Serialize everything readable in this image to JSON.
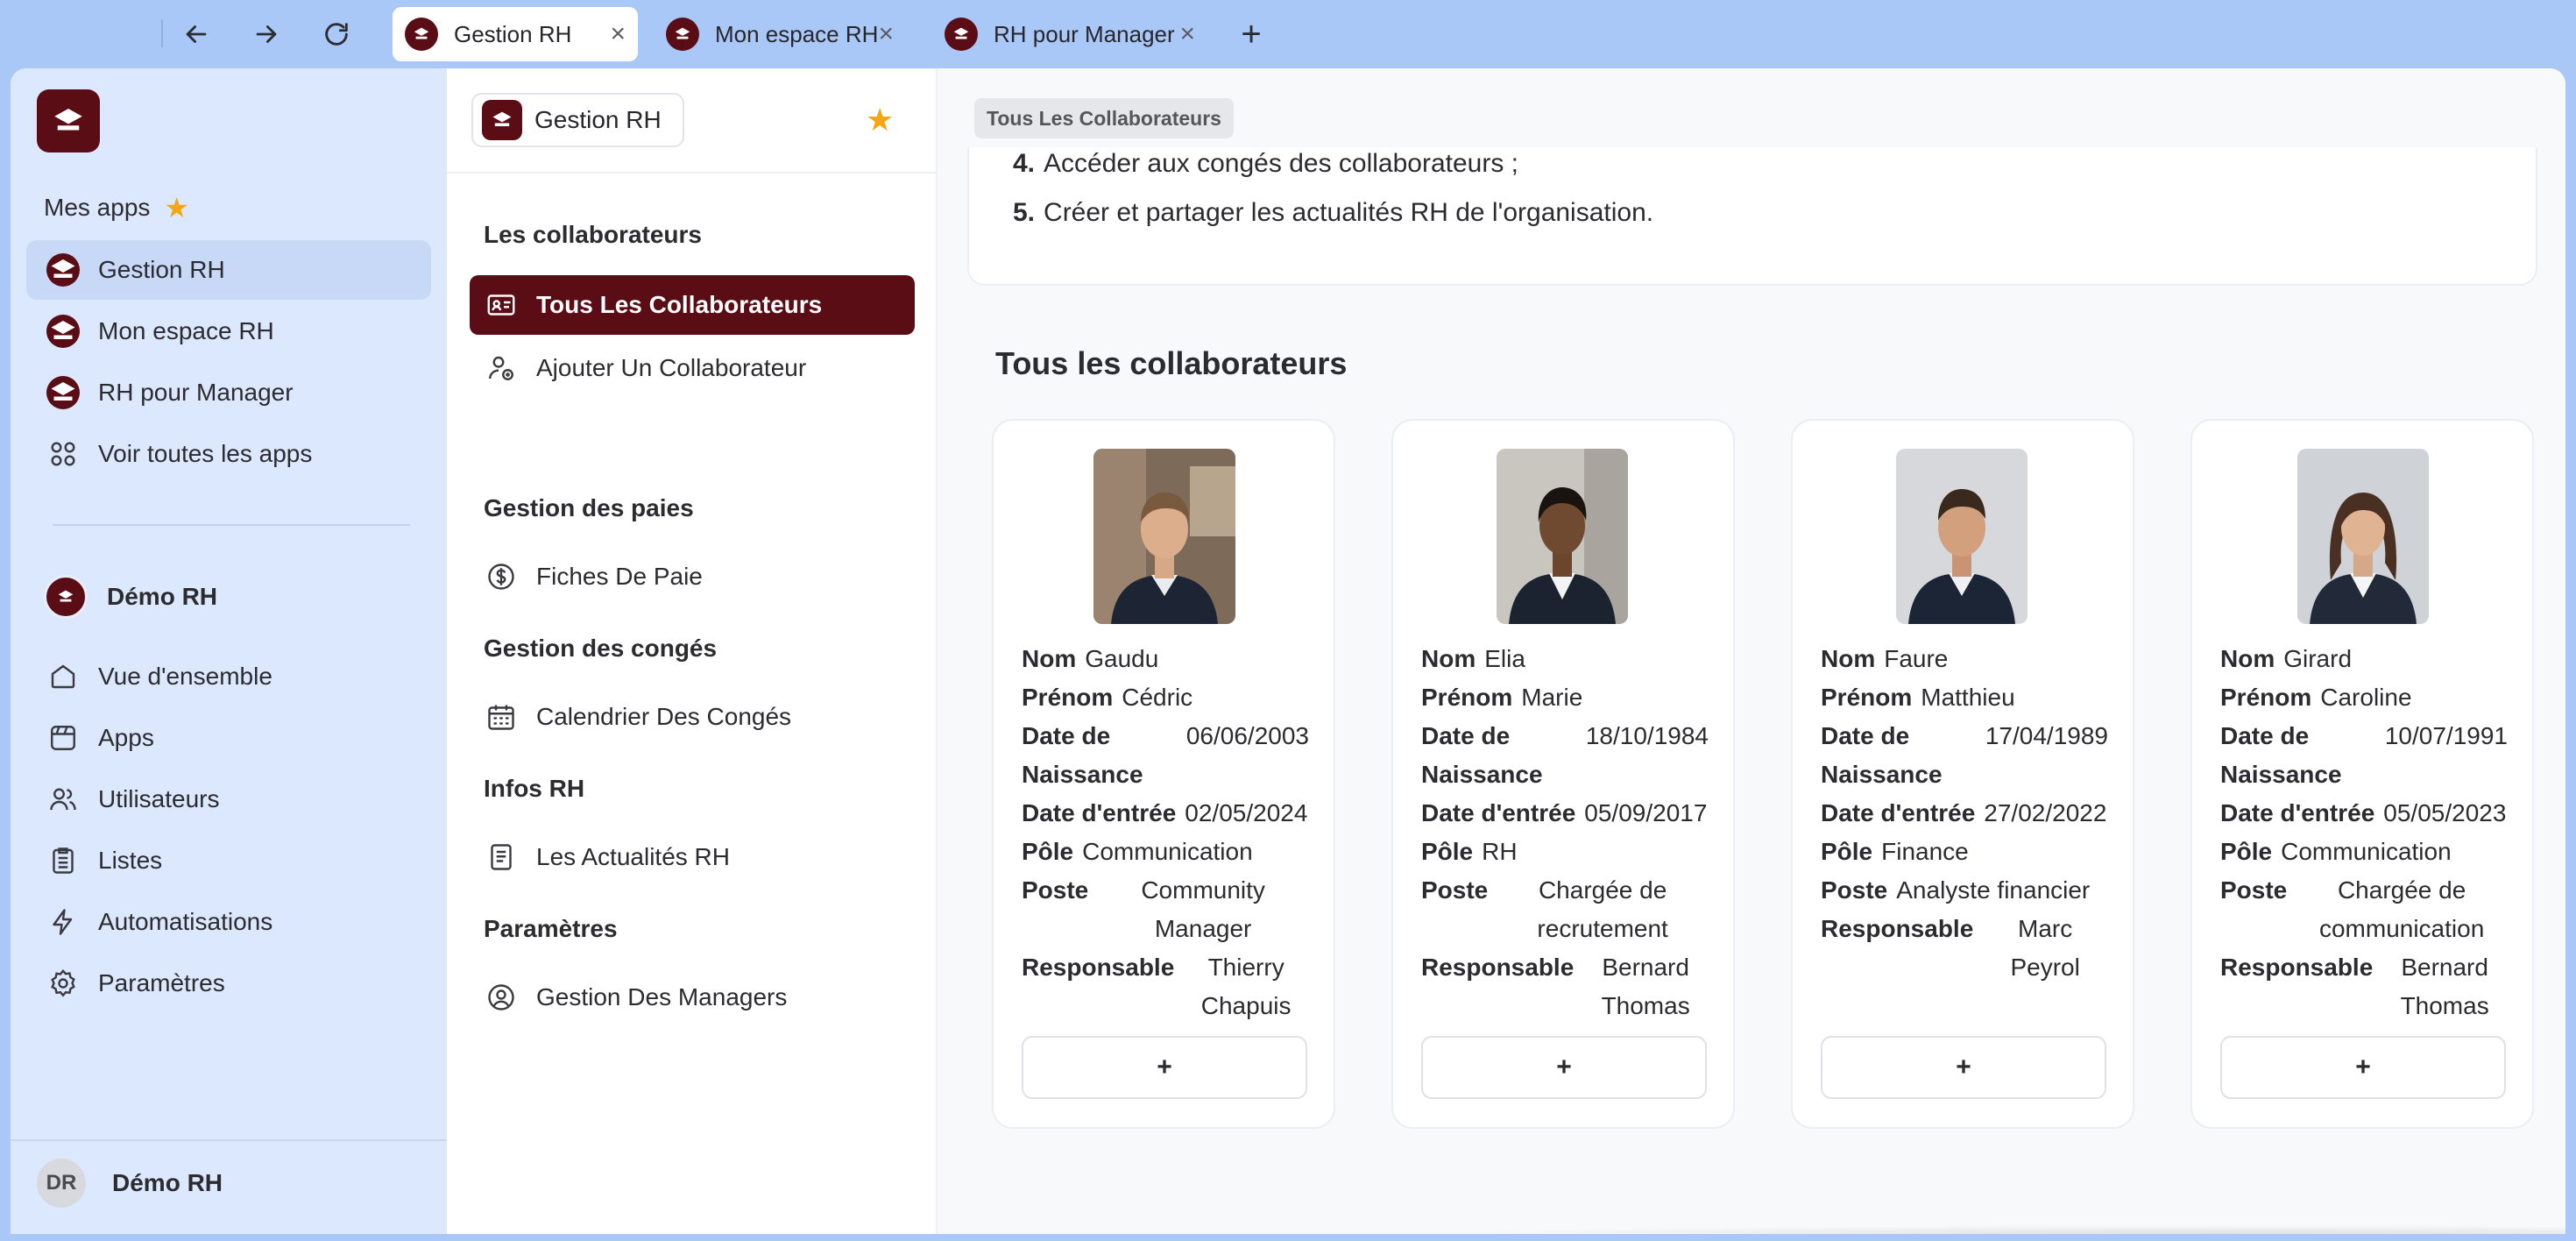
{
  "browser": {
    "tabs": [
      {
        "label": "Gestion RH",
        "active": true
      },
      {
        "label": "Mon espace RH",
        "active": false
      },
      {
        "label": "RH pour Manager",
        "active": false
      }
    ],
    "new_tab": "+",
    "close_glyph": "×"
  },
  "sidebar": {
    "mes_apps_label": "Mes apps",
    "apps": [
      {
        "label": "Gestion RH",
        "icon": "app-logo-icon",
        "active": true
      },
      {
        "label": "Mon espace RH",
        "icon": "app-logo-icon"
      },
      {
        "label": "RH pour Manager",
        "icon": "app-logo-icon"
      },
      {
        "label": "Voir toutes les apps",
        "icon": "grid-icon"
      }
    ],
    "org_name": "Démo RH",
    "org_items": [
      {
        "label": "Vue d'ensemble",
        "icon": "home-icon"
      },
      {
        "label": "Apps",
        "icon": "apps-icon"
      },
      {
        "label": "Utilisateurs",
        "icon": "users-icon"
      },
      {
        "label": "Listes",
        "icon": "list-icon"
      },
      {
        "label": "Automatisations",
        "icon": "bolt-icon"
      },
      {
        "label": "Paramètres",
        "icon": "gear-icon"
      }
    ],
    "user": {
      "initials": "DR",
      "name": "Démo RH"
    }
  },
  "secnav": {
    "app_name": "Gestion RH",
    "sections": [
      {
        "heading": "Les collaborateurs",
        "items": [
          {
            "label": "Tous Les Collaborateurs",
            "icon": "id-card-icon",
            "active": true
          },
          {
            "label": "Ajouter Un Collaborateur",
            "icon": "user-add-icon"
          }
        ]
      },
      {
        "heading": "Gestion des paies",
        "items": [
          {
            "label": "Fiches De Paie",
            "icon": "dollar-icon"
          }
        ]
      },
      {
        "heading": "Gestion des congés",
        "items": [
          {
            "label": "Calendrier Des Congés",
            "icon": "calendar-icon"
          }
        ]
      },
      {
        "heading": "Infos RH",
        "items": [
          {
            "label": "Les Actualités RH",
            "icon": "news-icon"
          }
        ]
      },
      {
        "heading": "Paramètres",
        "items": [
          {
            "label": "Gestion Des Managers",
            "icon": "user-circle-icon"
          }
        ]
      }
    ]
  },
  "main": {
    "breadcrumb": "Tous Les Collaborateurs",
    "intro_lines": [
      {
        "num": "4.",
        "text": "Accéder aux congés des collaborateurs ;"
      },
      {
        "num": "5.",
        "text": "Créer et partager les actualités RH de l'organisation."
      }
    ],
    "section_title": "Tous les collaborateurs",
    "labels": {
      "nom": "Nom",
      "prenom": "Prénom",
      "naissance": "Date de Naissance",
      "entree": "Date d'entrée",
      "pole": "Pôle",
      "poste": "Poste",
      "responsable": "Responsable"
    },
    "add_label": "+",
    "employees": [
      {
        "nom": "Gaudu",
        "prenom": "Cédric",
        "naissance": "06/06/2003",
        "entree": "02/05/2024",
        "pole": "Communication",
        "poste": "Community Manager",
        "responsable": "Thierry Chapuis"
      },
      {
        "nom": "Elia",
        "prenom": "Marie",
        "naissance": "18/10/1984",
        "entree": "05/09/2017",
        "pole": "RH",
        "poste": "Chargée de recrutement",
        "responsable": "Bernard Thomas"
      },
      {
        "nom": "Faure",
        "prenom": "Matthieu",
        "naissance": "17/04/1989",
        "entree": "27/02/2022",
        "pole": "Finance",
        "poste": "Analyste financier",
        "responsable": "Marc Peyrol"
      },
      {
        "nom": "Girard",
        "prenom": "Caroline",
        "naissance": "10/07/1991",
        "entree": "05/05/2023",
        "pole": "Communication",
        "poste": "Chargée de communication",
        "responsable": "Bernard Thomas"
      }
    ]
  },
  "colors": {
    "brand": "#5a0d14",
    "star": "#f3a712",
    "sidebar_bg": "#dce8fd",
    "chrome_bg": "#a9c8f7"
  }
}
